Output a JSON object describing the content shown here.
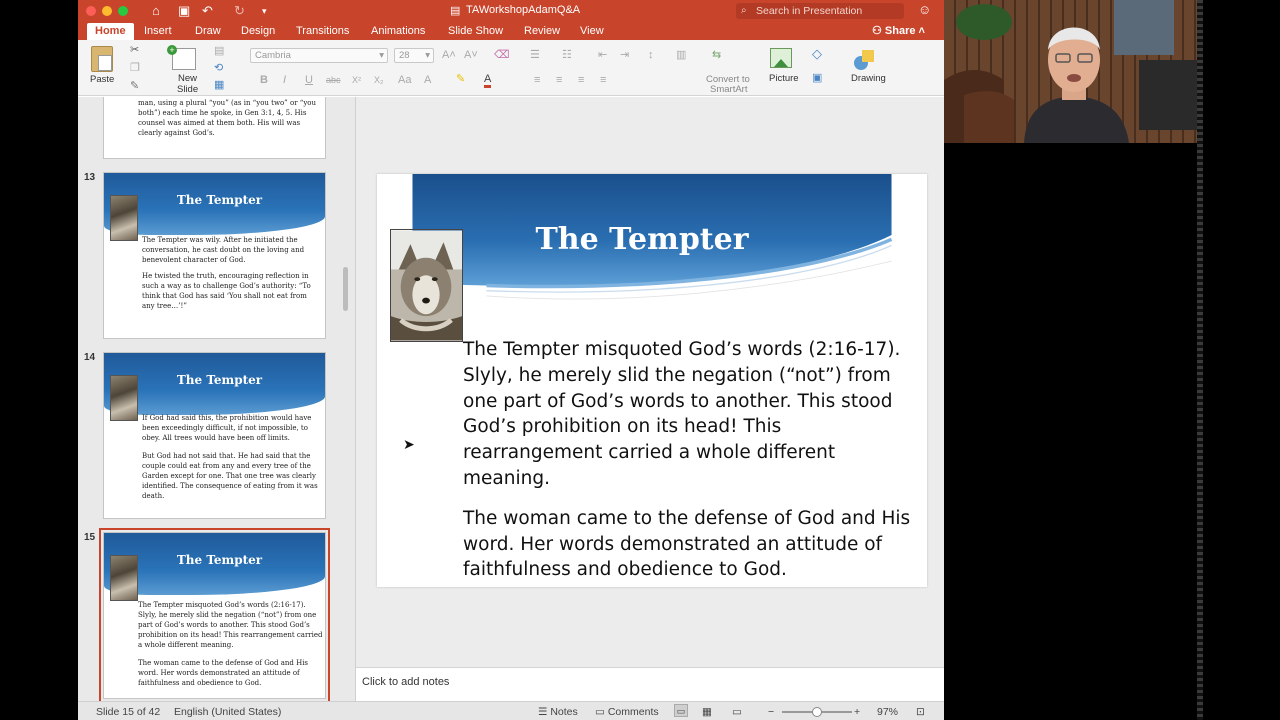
{
  "window": {
    "doc_title": "TAWorkshopAdamQ&A",
    "search_placeholder": "Search in Presentation",
    "share_label": "Share"
  },
  "tabs": [
    "Home",
    "Insert",
    "Draw",
    "Design",
    "Transitions",
    "Animations",
    "Slide Show",
    "Review",
    "View"
  ],
  "active_tab": "Home",
  "ribbon": {
    "paste": "Paste",
    "new_slide_1": "New",
    "new_slide_2": "Slide",
    "font_name": "Cambria",
    "font_size": "28",
    "convert_1": "Convert to",
    "convert_2": "SmartArt",
    "picture": "Picture",
    "drawing": "Drawing"
  },
  "thumbnails": [
    {
      "number": "",
      "partial_text": "man, using a plural “you” (as in “you two” or “you both”) each time he spoke, in Gen 3:1, 4, 5. His counsel was aimed at them both. His will was clearly against God’s."
    },
    {
      "number": "13",
      "title": "The Tempter",
      "p1": "The Tempter was wily. After he initiated the conversation, he cast doubt on the loving and benevolent character of God.",
      "p2": "He twisted the truth, encouraging reflection in such a way as to challenge God’s authority: “To think that God has said ‘You shall not eat from any tree…’!”"
    },
    {
      "number": "14",
      "title": "The Tempter",
      "p1": "If God had said this, the prohibition would have been exceedingly difficult, if not impossible, to obey. All trees would have been off limits.",
      "p2": "But God had not said that. He had said that the couple could eat from any and every tree of the Garden except for one. That one tree was clearly identified. The consequence of eating from it was death."
    },
    {
      "number": "15",
      "title": "The Tempter",
      "p1": "The Tempter misquoted God’s words (2:16-17). Slyly, he merely slid the negation (“not”) from one part of God’s words to another. This stood God’s prohibition on its head! This rearrangement carried a whole different meaning.",
      "p2": "The woman came to the defense of God and His word. Her words demonstrated an attitude of faithfulness and obedience to God."
    }
  ],
  "slide": {
    "title": "The Tempter",
    "p1": "The Tempter misquoted God’s words (2:16-17). Slyly, he merely slid the negation (“not”) from one part of God’s words to another. This stood God’s prohibition on its head! This rearrangement carried a whole different meaning.",
    "p2": "The woman came to the defense of God and His word. Her words demonstrated an attitude of faithfulness and obedience to God."
  },
  "notes_placeholder": "Click to add notes",
  "status": {
    "slide_info": "Slide 15 of 42",
    "language": "English (United States)",
    "notes": "Notes",
    "comments": "Comments",
    "zoom": "97%"
  },
  "colors": {
    "accent": "#c8442b",
    "banner": "#1f5a9a"
  }
}
